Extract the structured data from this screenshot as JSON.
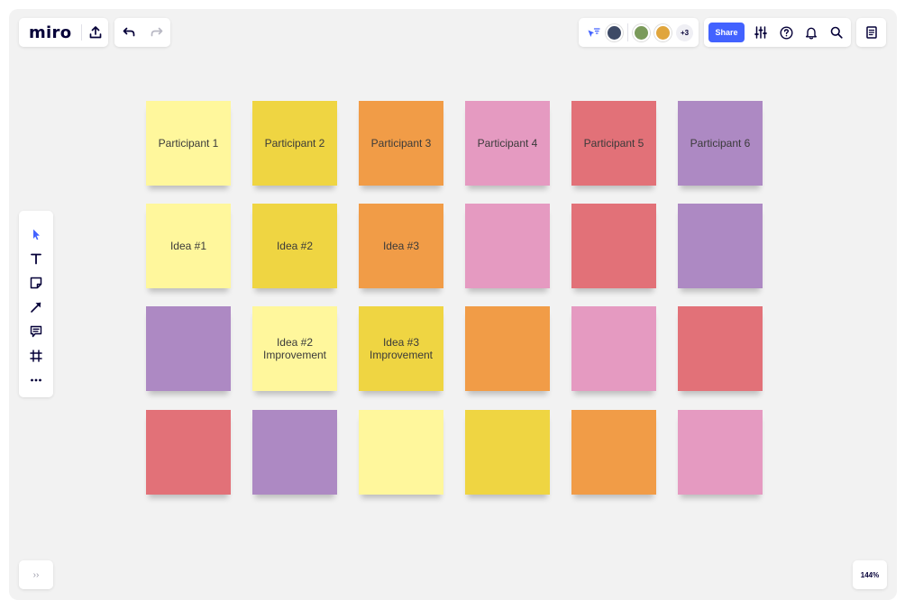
{
  "app": {
    "logo": "miro"
  },
  "collaboration": {
    "share_label": "Share",
    "extra_collaborators": "+3",
    "avatars": [
      {
        "name": "avatar-1",
        "color": "#3d4a66"
      },
      {
        "name": "avatar-2",
        "color": "#7a9a5a"
      },
      {
        "name": "avatar-3",
        "color": "#e0a53c"
      }
    ]
  },
  "board": {
    "zoom": "144%",
    "sticky_notes": [
      [
        {
          "text": "Participant 1",
          "color": "#fff79c"
        },
        {
          "text": "Participant 2",
          "color": "#efd542"
        },
        {
          "text": "Participant 3",
          "color": "#f19c47"
        },
        {
          "text": "Participant 4",
          "color": "#e59ac1"
        },
        {
          "text": "Participant 5",
          "color": "#e27178"
        },
        {
          "text": "Participant 6",
          "color": "#ad89c3"
        }
      ],
      [
        {
          "text": "Idea #1",
          "color": "#fff79c"
        },
        {
          "text": "Idea #2",
          "color": "#efd542"
        },
        {
          "text": "Idea #3",
          "color": "#f19c47"
        },
        {
          "text": "",
          "color": "#e59ac1"
        },
        {
          "text": "",
          "color": "#e27178"
        },
        {
          "text": "",
          "color": "#ad89c3"
        }
      ],
      [
        {
          "text": "",
          "color": "#ad89c3"
        },
        {
          "text": "Idea #2\nImprovement",
          "color": "#fff79c"
        },
        {
          "text": "Idea #3\nImprovement",
          "color": "#efd542"
        },
        {
          "text": "",
          "color": "#f19c47"
        },
        {
          "text": "",
          "color": "#e59ac1"
        },
        {
          "text": "",
          "color": "#e27178"
        }
      ],
      [
        {
          "text": "",
          "color": "#e27178"
        },
        {
          "text": "",
          "color": "#ad89c3"
        },
        {
          "text": "",
          "color": "#fff79c"
        },
        {
          "text": "",
          "color": "#efd542"
        },
        {
          "text": "",
          "color": "#f19c47"
        },
        {
          "text": "",
          "color": "#e59ac1"
        }
      ]
    ]
  },
  "toolbar": {
    "tools": [
      "select-tool",
      "text-tool",
      "sticky-note-tool",
      "connection-line-tool",
      "comment-tool",
      "frame-tool",
      "more-tools"
    ]
  },
  "footer": {
    "expand_label": "››"
  }
}
